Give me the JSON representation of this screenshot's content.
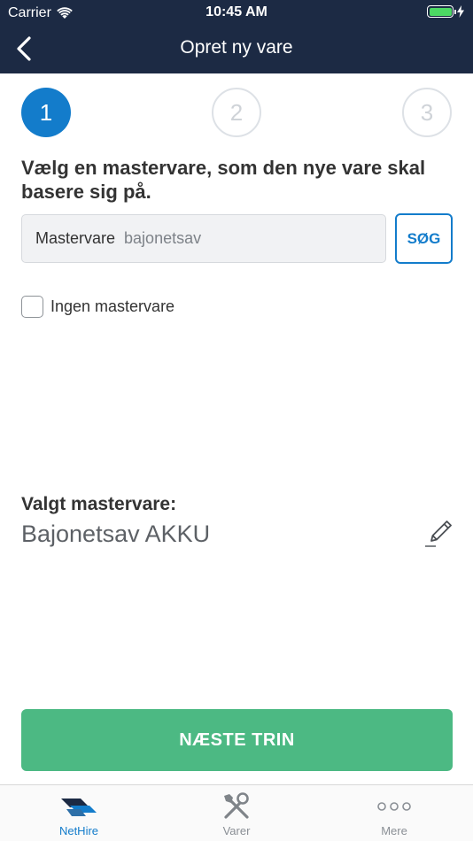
{
  "status_bar": {
    "carrier": "Carrier",
    "time": "10:45 AM"
  },
  "nav": {
    "title": "Opret ny vare",
    "back_icon": "chevron-left-icon"
  },
  "stepper": {
    "steps": [
      "1",
      "2",
      "3"
    ],
    "active_step": 1
  },
  "prompt": "Vælg en mastervare, som den nye vare skal basere sig på.",
  "search": {
    "label": "Mastervare",
    "value": "bajonetsav",
    "button_label": "SØG"
  },
  "no_master": {
    "label": "Ingen mastervare",
    "checked": false
  },
  "selected": {
    "label": "Valgt mastervare:",
    "value": "Bajonetsav AKKU",
    "edit_icon": "pencil-icon"
  },
  "next_button": {
    "label": "NÆSTE TRIN"
  },
  "tabs": [
    {
      "label": "NetHire",
      "icon": "nethire-logo-icon",
      "active": true
    },
    {
      "label": "Varer",
      "icon": "tools-icon",
      "active": false
    },
    {
      "label": "Mere",
      "icon": "more-dots-icon",
      "active": false
    }
  ],
  "colors": {
    "header": "#1c2a44",
    "accent": "#137ccb",
    "primary_button": "#4cb983",
    "battery": "#4cd964"
  }
}
